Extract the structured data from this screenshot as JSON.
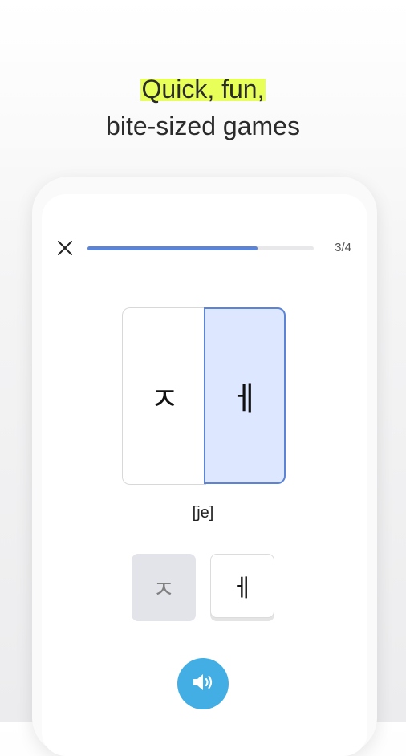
{
  "headline": {
    "line1": "Quick, fun,",
    "line2": "bite-sized games"
  },
  "quiz": {
    "progress_fraction": 0.75,
    "counter": "3/4",
    "card_left": "ㅈ",
    "card_right": "ㅔ",
    "pronunciation": "[je]",
    "options": [
      "ㅈ",
      "ㅔ"
    ]
  },
  "colors": {
    "accent": "#5b84d6",
    "highlight": "#e8ff5a",
    "audio_button": "#42aee4",
    "selected_card": "#dde7ff"
  },
  "icons": {
    "close": "close-icon",
    "audio": "speaker-icon"
  }
}
